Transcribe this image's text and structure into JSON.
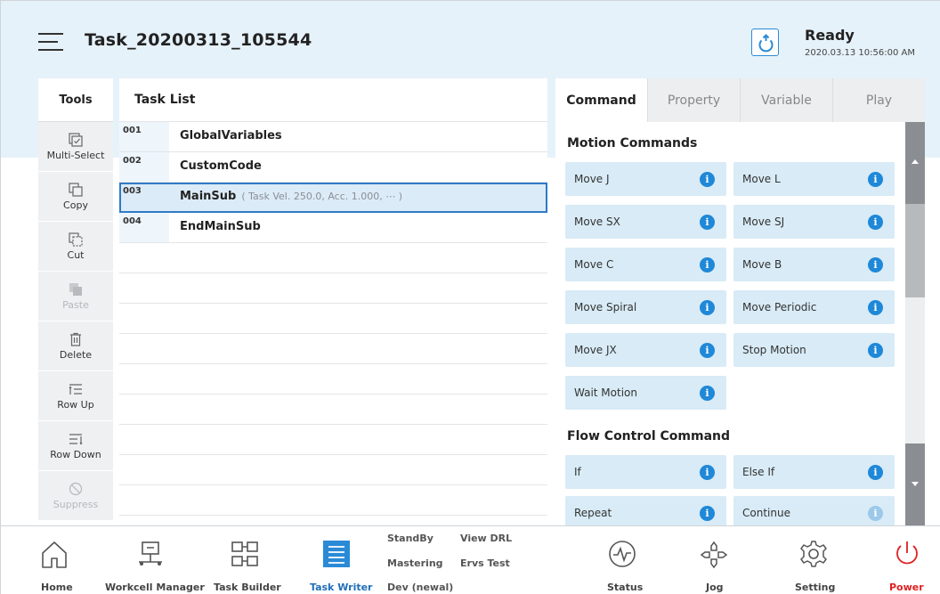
{
  "header": {
    "title": "Task_20200313_105544",
    "status": "Ready",
    "timestamp": "2020.03.13 10:56:00 AM"
  },
  "tools": {
    "title": "Tools",
    "items": [
      {
        "label": "Multi-Select",
        "icon": "multi-select-icon",
        "enabled": true
      },
      {
        "label": "Copy",
        "icon": "copy-icon",
        "enabled": true
      },
      {
        "label": "Cut",
        "icon": "cut-icon",
        "enabled": true
      },
      {
        "label": "Paste",
        "icon": "paste-icon",
        "enabled": false
      },
      {
        "label": "Delete",
        "icon": "trash-icon",
        "enabled": true
      },
      {
        "label": "Row Up",
        "icon": "row-up-icon",
        "enabled": true
      },
      {
        "label": "Row Down",
        "icon": "row-down-icon",
        "enabled": true
      },
      {
        "label": "Suppress",
        "icon": "suppress-icon",
        "enabled": false
      }
    ]
  },
  "task_list": {
    "title": "Task List",
    "rows": [
      {
        "num": "001",
        "name": "GlobalVariables",
        "detail": ""
      },
      {
        "num": "002",
        "name": "CustomCode",
        "detail": ""
      },
      {
        "num": "003",
        "name": "MainSub",
        "detail": "( Task Vel. 250.0, Acc. 1.000, ⋯ )"
      },
      {
        "num": "004",
        "name": "EndMainSub",
        "detail": ""
      }
    ]
  },
  "panel": {
    "tabs": [
      "Command",
      "Property",
      "Variable",
      "Play"
    ],
    "active_tab": "Command",
    "motion_title": "Motion Commands",
    "motion_commands": [
      "Move J",
      "Move L",
      "Move SX",
      "Move SJ",
      "Move C",
      "Move B",
      "Move Spiral",
      "Move Periodic",
      "Move JX",
      "Stop Motion",
      "Wait Motion"
    ],
    "flow_title": "Flow Control Command",
    "flow_commands": [
      "If",
      "Else If",
      "Repeat",
      "Continue"
    ]
  },
  "bottom_nav": {
    "home": "Home",
    "workcell": "Workcell Manager",
    "task_builder": "Task Builder",
    "task_writer": "Task Writer",
    "standby": "StandBy",
    "view_drl": "View DRL",
    "mastering": "Mastering",
    "ervs_test": "Ervs Test",
    "dev": "Dev (newal)",
    "status": "Status",
    "jog": "Jog",
    "setting": "Setting",
    "power": "Power"
  },
  "colors": {
    "header_bg": "#e6f2fa",
    "accent": "#1f88d8",
    "power": "#e02020"
  }
}
